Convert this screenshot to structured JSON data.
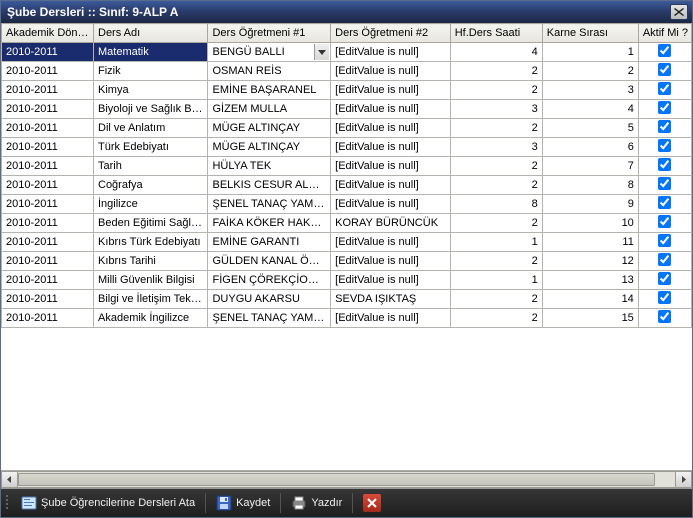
{
  "window": {
    "title": "Şube Dersleri :: Sınıf: 9-ALP A"
  },
  "columns": {
    "donem": "Akademik Dön…",
    "adi": "Ders Adı",
    "ogr1": "Ders Öğretmeni #1",
    "ogr2": "Ders Öğretmeni #2",
    "saat": "Hf.Ders Saati",
    "karne": "Karne Sırası",
    "aktif": "Aktif Mi ?"
  },
  "rows": [
    {
      "donem": "2010-2011",
      "adi": "Matematik",
      "ogr1": "BENGÜ BALLI",
      "ogr2": "[EditValue is null]",
      "saat": 4,
      "karne": 1,
      "aktif": true,
      "selected": true
    },
    {
      "donem": "2010-2011",
      "adi": "Fizik",
      "ogr1": "OSMAN REİS",
      "ogr2": "[EditValue is null]",
      "saat": 2,
      "karne": 2,
      "aktif": true
    },
    {
      "donem": "2010-2011",
      "adi": "Kimya",
      "ogr1": "EMİNE BAŞARANEL",
      "ogr2": "[EditValue is null]",
      "saat": 2,
      "karne": 3,
      "aktif": true
    },
    {
      "donem": "2010-2011",
      "adi": "Biyoloji ve Sağlık Bil…",
      "ogr1": "GİZEM MULLA",
      "ogr2": "[EditValue is null]",
      "saat": 3,
      "karne": 4,
      "aktif": true
    },
    {
      "donem": "2010-2011",
      "adi": "Dil ve Anlatım",
      "ogr1": "MÜGE ALTINÇAY",
      "ogr2": "[EditValue is null]",
      "saat": 2,
      "karne": 5,
      "aktif": true
    },
    {
      "donem": "2010-2011",
      "adi": "Türk Edebiyatı",
      "ogr1": "MÜGE ALTINÇAY",
      "ogr2": "[EditValue is null]",
      "saat": 3,
      "karne": 6,
      "aktif": true
    },
    {
      "donem": "2010-2011",
      "adi": "Tarih",
      "ogr1": "HÜLYA TEK",
      "ogr2": "[EditValue is null]",
      "saat": 2,
      "karne": 7,
      "aktif": true
    },
    {
      "donem": "2010-2011",
      "adi": "Coğrafya",
      "ogr1": "BELKIS CESUR ALPSOY",
      "ogr2": "[EditValue is null]",
      "saat": 2,
      "karne": 8,
      "aktif": true
    },
    {
      "donem": "2010-2011",
      "adi": "İngilizce",
      "ogr1": "ŞENEL TANAÇ YAMAN",
      "ogr2": "[EditValue is null]",
      "saat": 8,
      "karne": 9,
      "aktif": true
    },
    {
      "donem": "2010-2011",
      "adi": "Beden Eğitimi Sağlı…",
      "ogr1": "FAİKA KÖKER HAKVE…",
      "ogr2": "KORAY BÜRÜNCÜK",
      "saat": 2,
      "karne": 10,
      "aktif": true
    },
    {
      "donem": "2010-2011",
      "adi": "Kıbrıs Türk Edebiyatı",
      "ogr1": "EMİNE GARANTI",
      "ogr2": "[EditValue is null]",
      "saat": 1,
      "karne": 11,
      "aktif": true
    },
    {
      "donem": "2010-2011",
      "adi": "Kıbrıs Tarihi",
      "ogr1": "GÜLDEN KANAL ÖYCÜM",
      "ogr2": "[EditValue is null]",
      "saat": 2,
      "karne": 12,
      "aktif": true
    },
    {
      "donem": "2010-2011",
      "adi": "Milli Güvenlik Bilgisi",
      "ogr1": "FİGEN ÇÖREKÇİOĞLU",
      "ogr2": "[EditValue is null]",
      "saat": 1,
      "karne": 13,
      "aktif": true
    },
    {
      "donem": "2010-2011",
      "adi": "Bilgi ve İletişim Tek…",
      "ogr1": "DUYGU AKARSU",
      "ogr2": "SEVDA IŞIKTAŞ",
      "saat": 2,
      "karne": 14,
      "aktif": true
    },
    {
      "donem": "2010-2011",
      "adi": "Akademik İngilizce",
      "ogr1": "ŞENEL TANAÇ YAMAN",
      "ogr2": "[EditValue is null]",
      "saat": 2,
      "karne": 15,
      "aktif": true
    }
  ],
  "toolbar": {
    "ata": "Şube Öğrencilerine Dersleri Ata",
    "kaydet": "Kaydet",
    "yazdir": "Yazdır"
  }
}
